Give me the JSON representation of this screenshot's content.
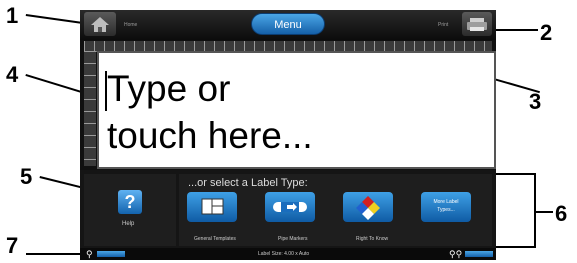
{
  "callouts": [
    "1",
    "2",
    "3",
    "4",
    "5",
    "6",
    "7"
  ],
  "topbar": {
    "home_label": "Home",
    "menu_label": "Menu",
    "print_label": "Print"
  },
  "editor": {
    "placeholder_line1": "Type or",
    "placeholder_line2": "touch here..."
  },
  "help": {
    "label": "Help",
    "icon": "?"
  },
  "label_types": {
    "title": "...or select a Label Type:",
    "items": [
      {
        "label": "General Templates",
        "icon": "template-icon"
      },
      {
        "label": "Pipe Markers",
        "icon": "pipe-marker-icon"
      },
      {
        "label": "Right To Know",
        "icon": "hazard-diamond-icon"
      },
      {
        "label": "More Label Types...",
        "line1": "More Label",
        "line2": "Types..."
      }
    ]
  },
  "status": {
    "label_size": "Label Size: 4.00 x Auto"
  },
  "colors": {
    "accent_blue": "#1e7fd0",
    "background": "#101010"
  }
}
